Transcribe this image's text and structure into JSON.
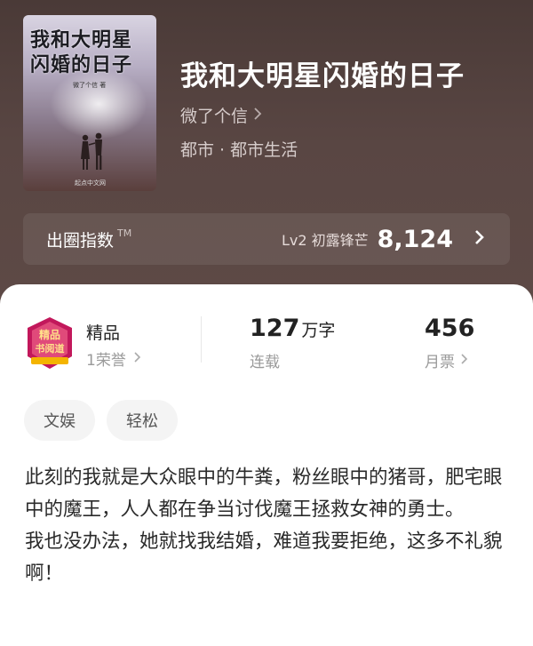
{
  "book": {
    "title": "我和大明星闪婚的日子",
    "author": "微了个信",
    "genre": "都市 · 都市生活",
    "cover": {
      "title_text": "我和大明星\n闪婚的日子",
      "author_text": "微了个信 著",
      "publisher_text": "起点中文网"
    }
  },
  "metric": {
    "label": "出圈指数",
    "tm": "TM",
    "level": "Lv2 初露锋芒",
    "value": "8,124",
    "chevron": "chevron-right-icon"
  },
  "stats": {
    "honor_title": "精品",
    "honor_sub": "1荣誉",
    "badge_text": "精品\n书阅读",
    "words_value": "127",
    "words_unit": "万字",
    "words_label": "连载",
    "ticket_value": "456",
    "ticket_label": "月票"
  },
  "tags": [
    "文娱",
    "轻松"
  ],
  "description": [
    "此刻的我就是大众眼中的牛粪，粉丝眼中的猪哥，肥宅眼中的魔王，人人都在争当讨伐魔王拯救女神的勇士。",
    "我也没办法，她就找我结婚，难道我要拒绝，这多不礼貌啊！"
  ],
  "colors": {
    "hero_bg": "#594643",
    "badge_primary": "#c2185b",
    "badge_gold": "#f4b400"
  }
}
